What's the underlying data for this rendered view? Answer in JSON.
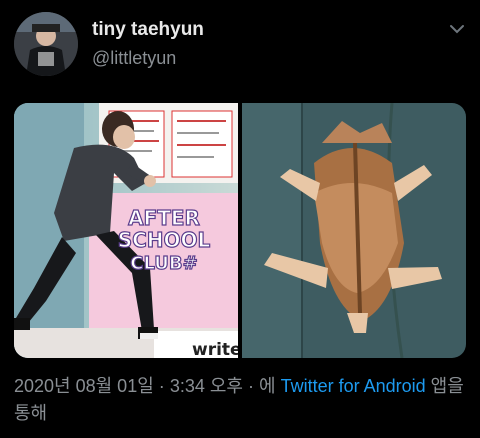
{
  "tweet": {
    "display_name": "tiny taehyun",
    "handle": "@littletyun",
    "date": "2020년 08월 01일",
    "separator": "·",
    "time": "3:34 오후",
    "via_prefix": "에",
    "source": "Twitter for Android",
    "via_suffix": "앱을 통해"
  },
  "media": {
    "left_photo": {
      "sign_line1": "AFTER",
      "sign_line2": "SCHOOL",
      "sign_line3": "CLUB#",
      "caption": "write"
    },
    "right_photo": {}
  },
  "icons": {
    "menu": "chevron-down-icon"
  },
  "colors": {
    "background": "#000000",
    "link": "#1d9bf0",
    "muted": "#8a8f94",
    "text": "#e9e9e9"
  }
}
